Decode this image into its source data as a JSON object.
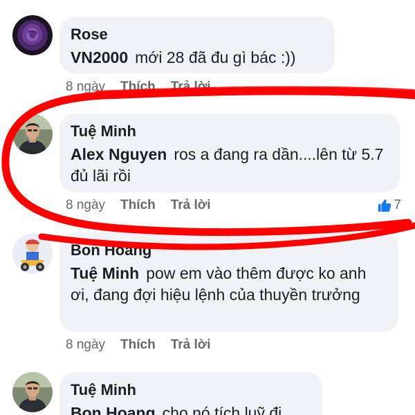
{
  "colors": {
    "bubble_bg": "#f0f2f5",
    "text": "#1c1e21",
    "meta": "#65676b",
    "like_blue": "#1877f2",
    "annotation_red": "#ff0000"
  },
  "comments": [
    {
      "author": "Rose",
      "mention": "VN2000",
      "text": "mới 28 đã đu gì bác :))",
      "time": "8 ngày",
      "like_label": "Thích",
      "reply_label": "Trả lời",
      "avatar_icon": "purple-rose-icon"
    },
    {
      "author": "Tuệ Minh",
      "mention": "Alex Nguyen",
      "text": "ros a đang ra dần....lên từ 5.7 đủ lãi rồi",
      "time": "8 ngày",
      "like_label": "Thích",
      "reply_label": "Trả lời",
      "reaction_count": "7",
      "avatar_icon": "man-portrait-icon"
    },
    {
      "author": "Bon Hoang",
      "mention": "Tuệ Minh",
      "text": "pow em vào thêm được ko anh ơi, đang đợi hiệu lệnh của thuyền trưởng",
      "time": "8 ngày",
      "like_label": "Thích",
      "reply_label": "Trả lời",
      "avatar_icon": "cartoon-motorbike-icon"
    },
    {
      "author": "Tuệ Minh",
      "mention": "Bon Hoang",
      "text": "cho nó tích luỹ đi",
      "avatar_icon": "man-portrait-icon"
    }
  ]
}
